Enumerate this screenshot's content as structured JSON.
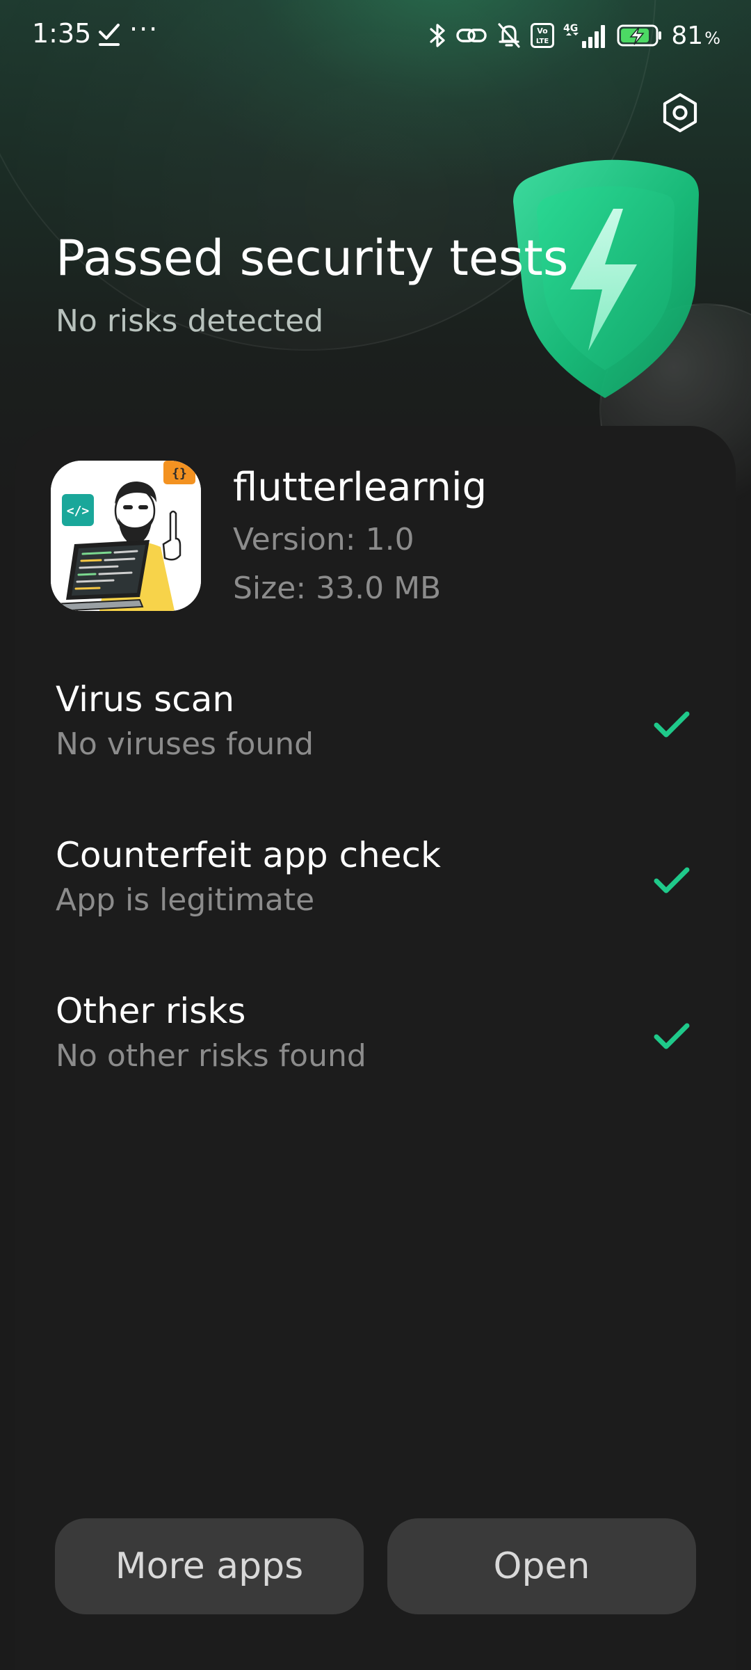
{
  "status_bar": {
    "time": "1:35",
    "dots": "···",
    "battery_percent": "81",
    "battery_unit": "%",
    "network_label": "4G",
    "volte_label": "Vo LTE"
  },
  "header": {
    "title": "Passed security tests",
    "subtitle": "No risks detected",
    "settings_icon": "settings-hexagon-icon",
    "shield_icon": "shield-lightning-icon"
  },
  "app": {
    "name": "flutterlearnig",
    "version": "Version: 1.0",
    "size": "Size: 33.0 MB",
    "icon_code_symbol": "</>",
    "icon_brace_symbol": "{}"
  },
  "checks": [
    {
      "title": "Virus scan",
      "subtitle": "No viruses found"
    },
    {
      "title": "Counterfeit app check",
      "subtitle": "App is legitimate"
    },
    {
      "title": "Other risks",
      "subtitle": "No other risks found"
    }
  ],
  "buttons": {
    "more_apps": "More apps",
    "open": "Open"
  },
  "colors": {
    "accent_green": "#1fc98a",
    "background": "#1b1b1b",
    "button_bg": "#3a3a3a",
    "muted_text": "#8c8c8c"
  }
}
